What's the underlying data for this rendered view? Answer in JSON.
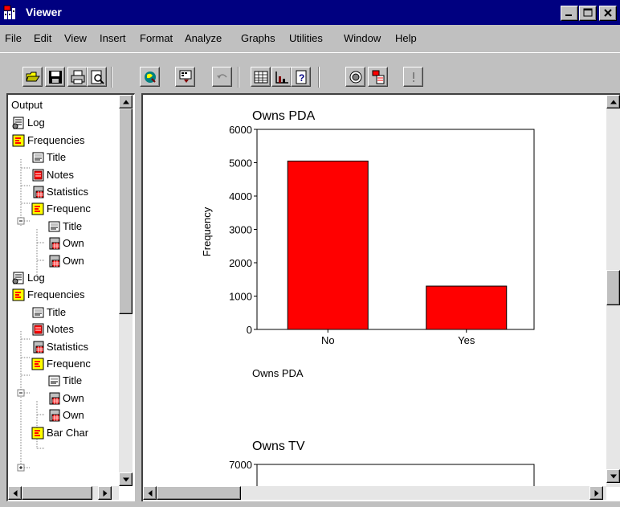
{
  "window": {
    "title": "Viewer"
  },
  "menu": [
    "File",
    "Edit",
    "View",
    "Insert",
    "Format",
    "Analyze",
    "Graphs",
    "Utilities",
    "Window",
    "Help"
  ],
  "toolbar": {
    "buttons": [
      "open-icon",
      "save-icon",
      "print-icon",
      "print-preview-icon",
      "export-icon",
      "recall-dialog-icon",
      "undo-icon",
      "goto-data-icon",
      "goto-chart-icon",
      "variables-icon",
      "use-sets-icon",
      "designate-window-icon",
      "run-icon"
    ]
  },
  "outline": {
    "items": [
      {
        "label": "Output",
        "icon": "none",
        "level": 0
      },
      {
        "label": "Log",
        "icon": "log-icon",
        "level": 0
      },
      {
        "label": "Frequencies",
        "icon": "procedure-icon",
        "level": 0
      },
      {
        "label": "Title",
        "icon": "title-icon",
        "level": 1
      },
      {
        "label": "Notes",
        "icon": "notes-icon",
        "level": 1
      },
      {
        "label": "Statistics",
        "icon": "table-icon",
        "level": 1
      },
      {
        "label": "Frequenc",
        "icon": "procedure-icon",
        "level": 1
      },
      {
        "label": "Title",
        "icon": "title-icon",
        "level": 2
      },
      {
        "label": "Own",
        "icon": "table-icon",
        "level": 2
      },
      {
        "label": "Own",
        "icon": "table-icon",
        "level": 2
      },
      {
        "label": "Log",
        "icon": "log-icon",
        "level": 0
      },
      {
        "label": "Frequencies",
        "icon": "procedure-icon",
        "level": 0
      },
      {
        "label": "Title",
        "icon": "title-icon",
        "level": 1
      },
      {
        "label": "Notes",
        "icon": "notes-icon",
        "level": 1
      },
      {
        "label": "Statistics",
        "icon": "table-icon",
        "level": 1
      },
      {
        "label": "Frequenc",
        "icon": "procedure-icon",
        "level": 1
      },
      {
        "label": "Title",
        "icon": "title-icon",
        "level": 2
      },
      {
        "label": "Own",
        "icon": "table-icon",
        "level": 2
      },
      {
        "label": "Own",
        "icon": "table-icon",
        "level": 2
      },
      {
        "label": "Bar Char",
        "icon": "procedure-icon",
        "level": 1
      }
    ]
  },
  "colors": {
    "bar_fill": "#ff0000",
    "title_bar": "#000080",
    "face": "#c0c0c0"
  },
  "chart_data": [
    {
      "type": "bar",
      "title": "Owns PDA",
      "xlabel": "Owns PDA",
      "ylabel": "Frequency",
      "categories": [
        "No",
        "Yes"
      ],
      "values": [
        5050,
        1300
      ],
      "ylim": [
        0,
        6000
      ],
      "yticks": [
        "0",
        "1000",
        "2000",
        "3000",
        "4000",
        "5000",
        "6000"
      ],
      "color": "#ff0000"
    },
    {
      "type": "bar",
      "title": "Owns TV",
      "ylim": [
        0,
        7000
      ],
      "yticks": [
        "7000"
      ],
      "partial": true
    }
  ]
}
